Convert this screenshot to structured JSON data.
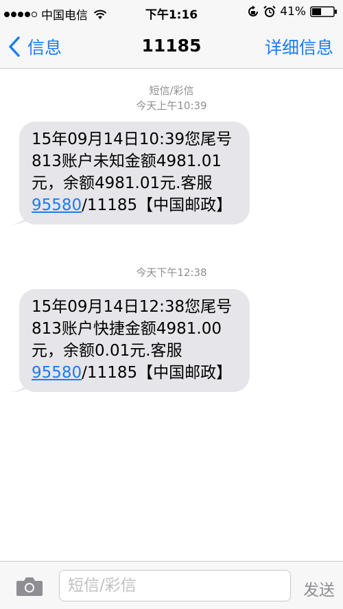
{
  "status_bar": {
    "carrier": "中国电信",
    "time": "下午1:16",
    "battery": "41%"
  },
  "nav": {
    "back_label": "信息",
    "title": "11185",
    "details_label": "详细信息"
  },
  "conversation": {
    "channel_label": "短信/彩信",
    "messages": [
      {
        "timestamp": "今天上午10:39",
        "text_before": "15年09月14日10:39您尾号813账户未知金额4981.01元，余额4981.01元.客服",
        "phone": "95580",
        "text_after": "/11185【中国邮政】"
      },
      {
        "timestamp": "今天下午12:38",
        "text_before": "15年09月14日12:38您尾号813账户快捷金额4981.00元，余额0.01元.客服",
        "phone": "95580",
        "text_after": "/11185【中国邮政】"
      }
    ]
  },
  "input_bar": {
    "placeholder": "短信/彩信",
    "send_label": "发送"
  },
  "colors": {
    "accent": "#1a7cf5",
    "bubble": "#e5e5ea",
    "meta_text": "#8e8e93"
  }
}
